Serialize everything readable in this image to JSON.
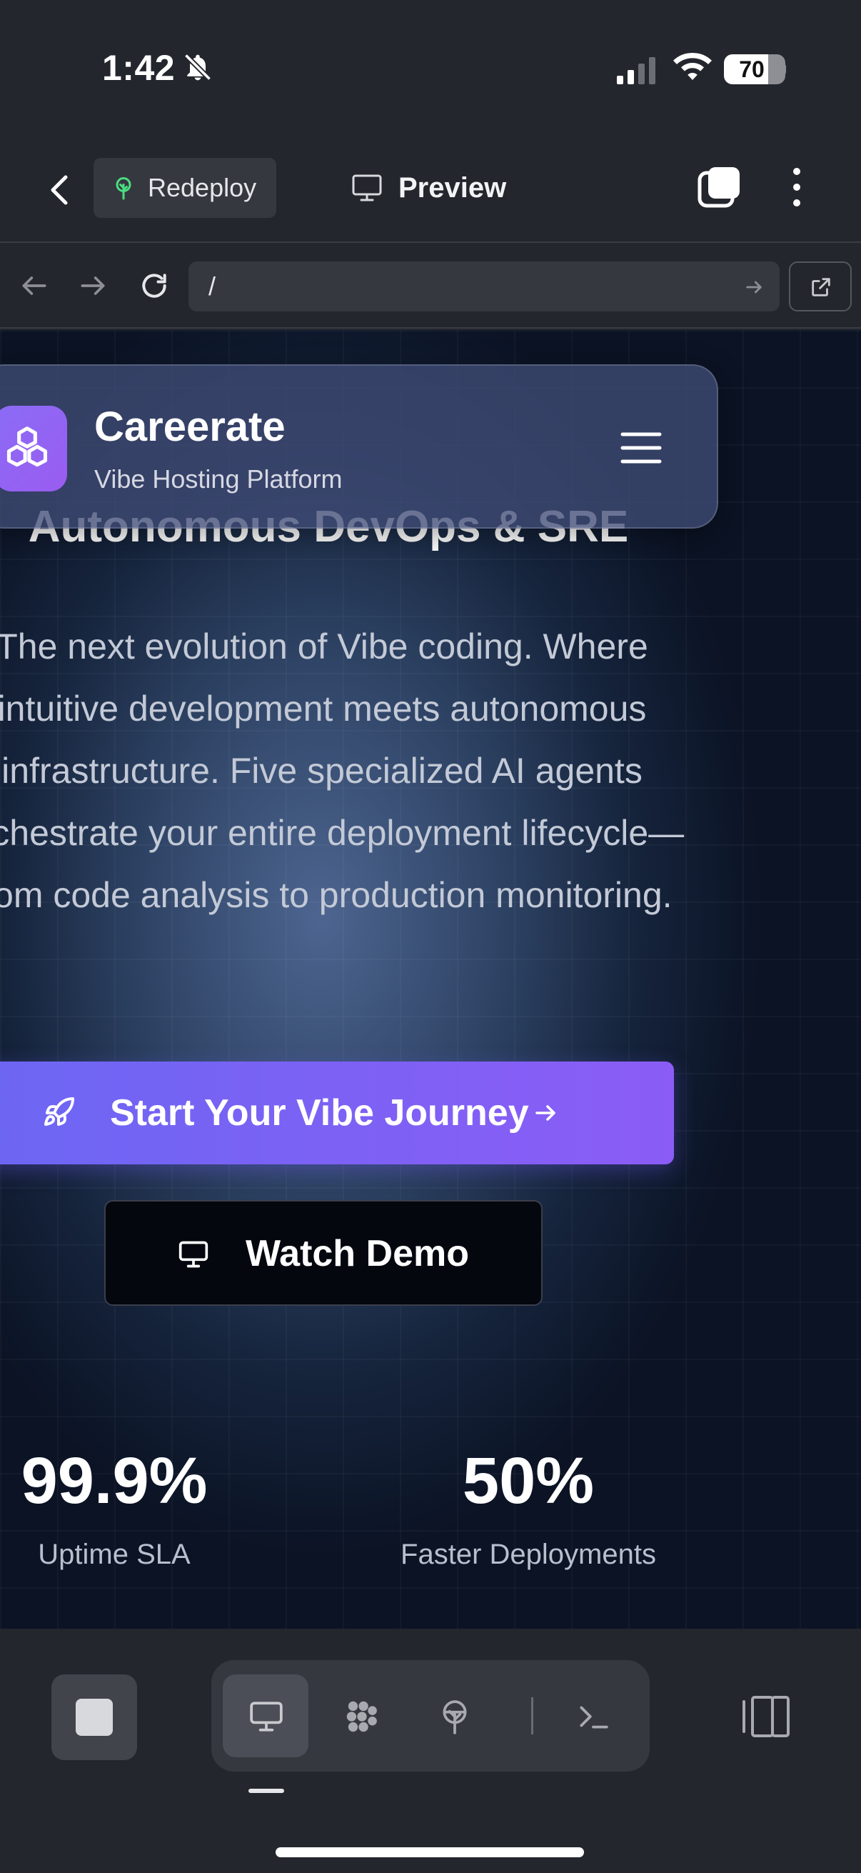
{
  "status_bar": {
    "time": "1:42",
    "battery_percent": "70",
    "icons": [
      "bell-slash-icon",
      "cellular-signal-icon",
      "wifi-icon",
      "battery-icon"
    ]
  },
  "app_toolbar": {
    "redeploy_label": "Redeploy",
    "preview_label": "Preview"
  },
  "browser": {
    "url": "/"
  },
  "site": {
    "brand_name": "Careerate",
    "brand_tagline": "Vibe Hosting Platform",
    "hero_subtitle": "Autonomous DevOps & SRE",
    "description": "The next evolution of Vibe coding. Where intuitive development meets autonomous infrastructure. Five specialized AI agents orchestrate your entire deployment lifecycle—from code analysis to production monitoring.",
    "cta_primary": "Start Your Vibe Journey",
    "cta_secondary": "Watch Demo",
    "stats": [
      {
        "value": "99.9%",
        "label": "Uptime SLA"
      },
      {
        "value": "50%",
        "label": "Faster Deployments"
      }
    ]
  },
  "colors": {
    "accent_gradient_start": "#6b67f3",
    "accent_gradient_end": "#8b5cf6",
    "app_chrome": "#24262d"
  },
  "bottom_bar": {
    "view_modes": [
      "monitor-icon",
      "agents-icon",
      "deploy-icon",
      "terminal-icon"
    ],
    "active_view": "monitor-icon"
  }
}
